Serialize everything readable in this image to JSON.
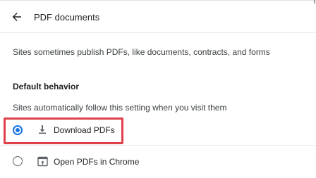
{
  "header": {
    "title": "PDF documents",
    "back_icon": "arrow-left-icon"
  },
  "description": "Sites sometimes publish PDFs, like documents, contracts, and forms",
  "default_behavior": {
    "heading": "Default behavior",
    "subtext": "Sites automatically follow this setting when you visit them",
    "options": [
      {
        "label": "Download PDFs",
        "icon": "download-icon",
        "selected": true
      },
      {
        "label": "Open PDFs in Chrome",
        "icon": "open-in-new-icon",
        "selected": false
      }
    ]
  },
  "colors": {
    "accent": "#1a73e8",
    "highlight": "#e0404a",
    "text": "#202124"
  }
}
